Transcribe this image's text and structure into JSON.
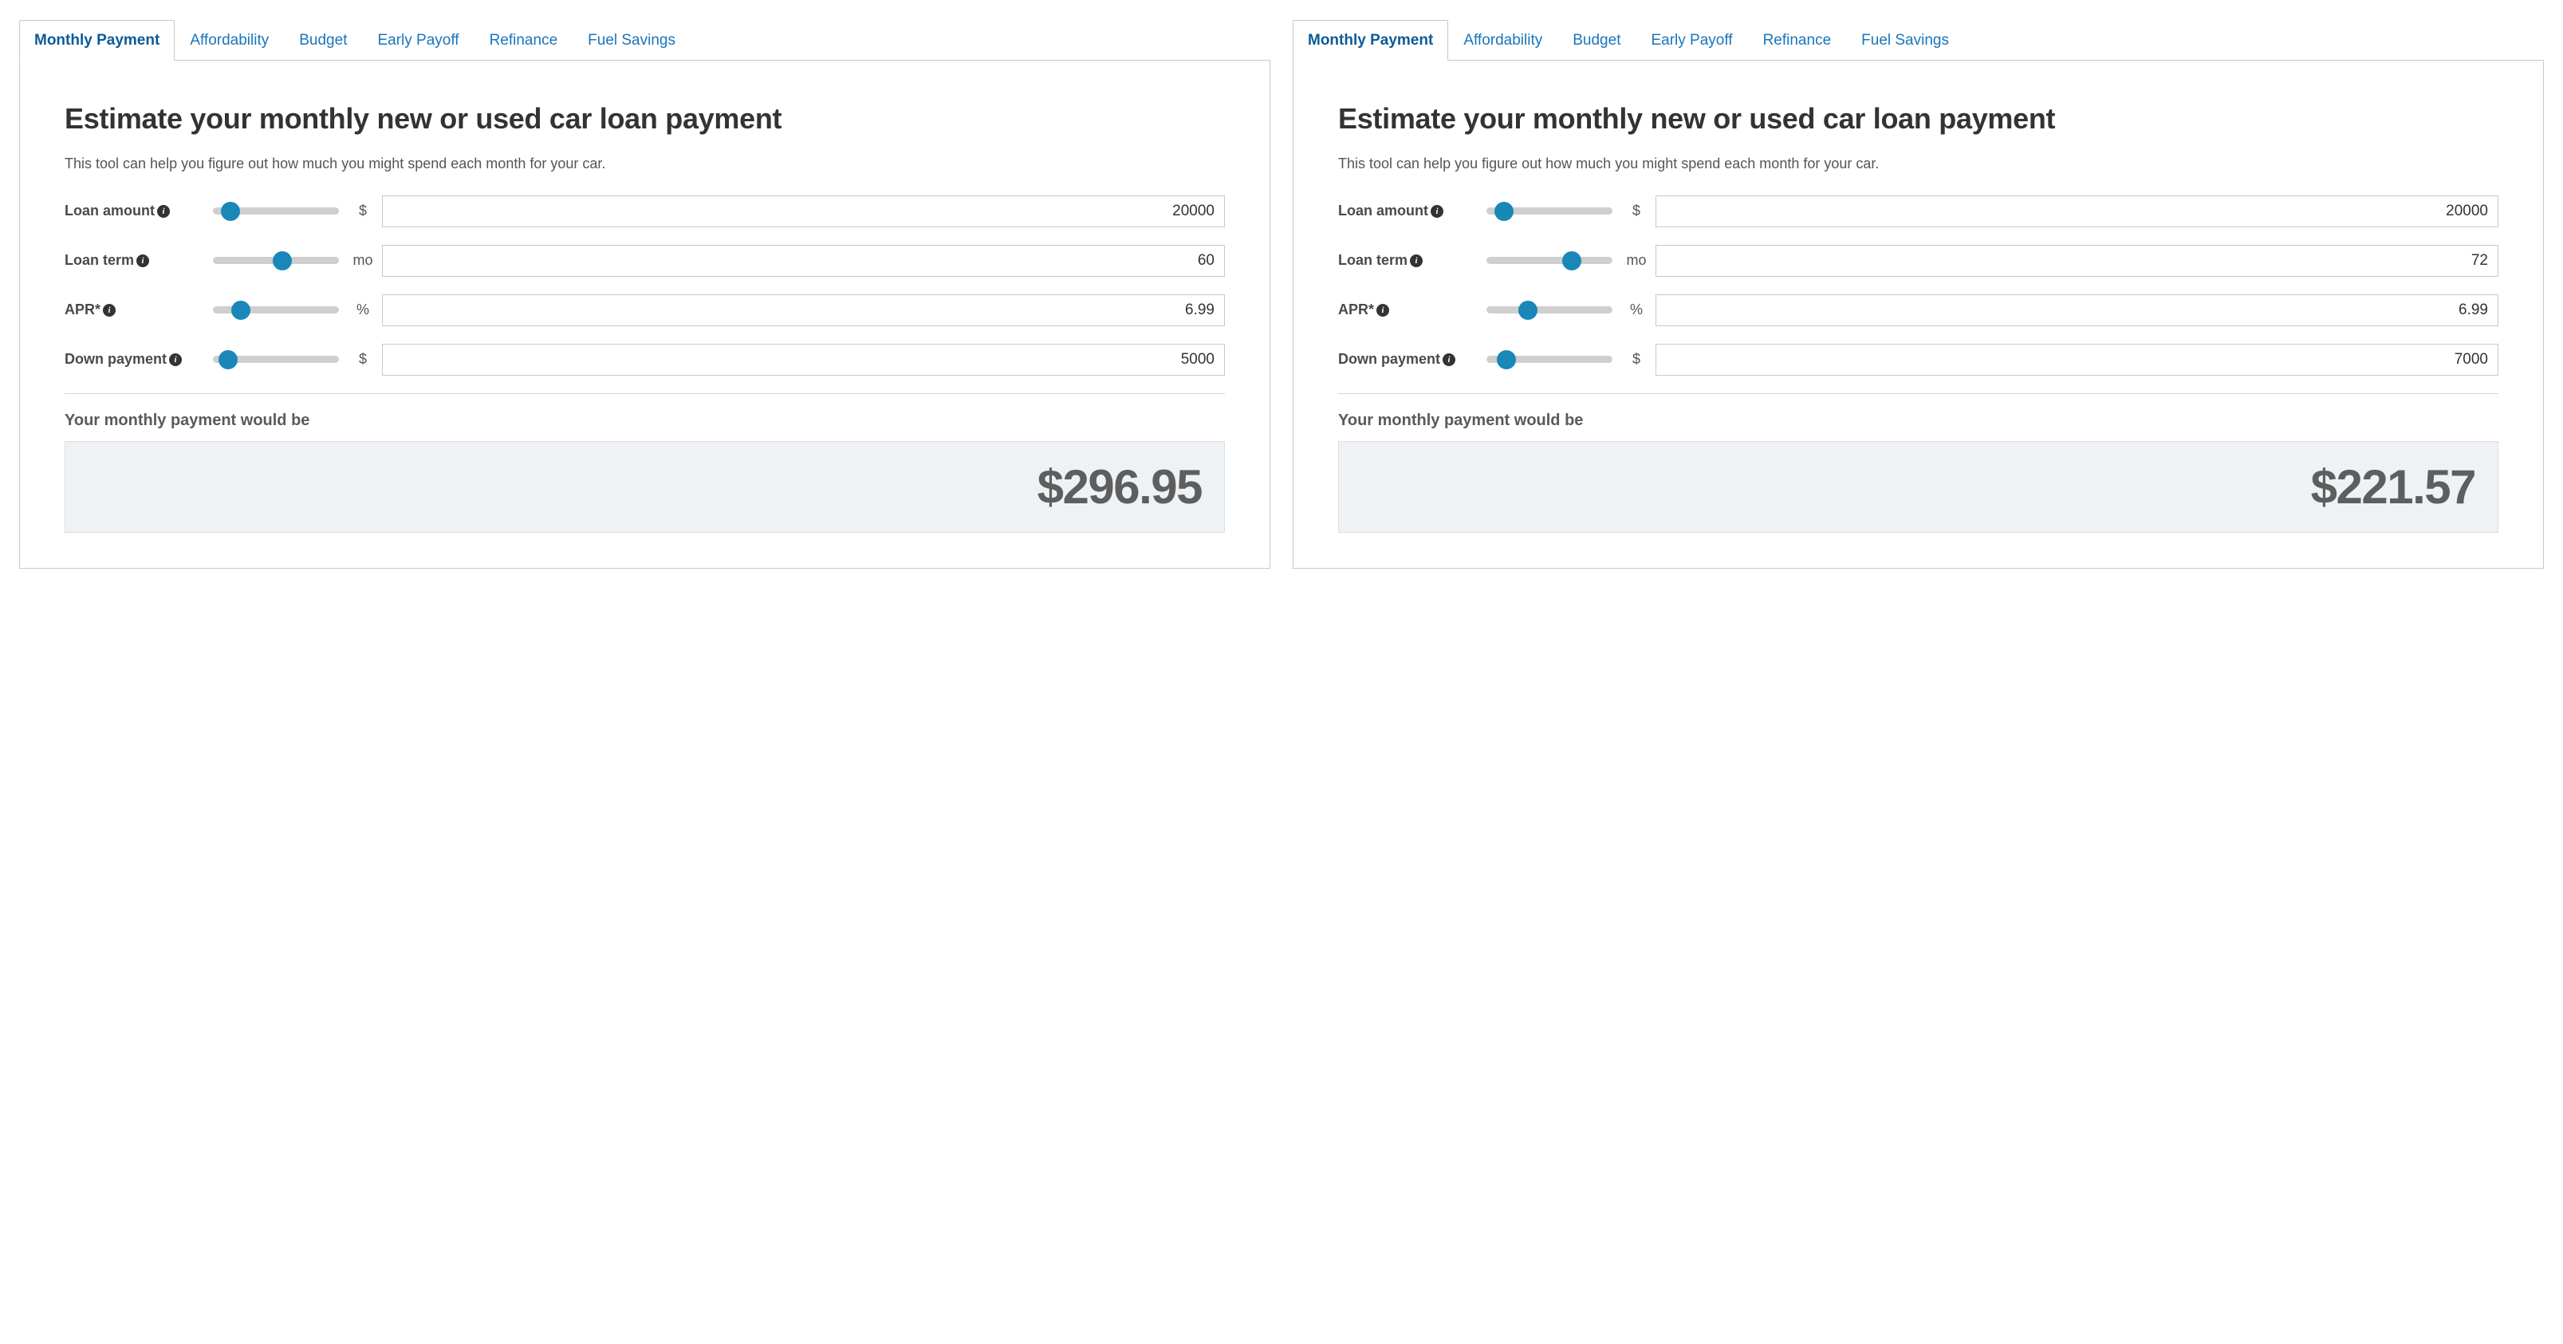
{
  "tabs": [
    "Monthly Payment",
    "Affordability",
    "Budget",
    "Early Payoff",
    "Refinance",
    "Fuel Savings"
  ],
  "active_tab_index": 0,
  "heading": "Estimate your monthly new or used car loan payment",
  "subheading": "This tool can help you figure out how much you might spend each month for your car.",
  "field_labels": {
    "loan_amount": "Loan amount",
    "loan_term": "Loan term",
    "apr": "APR*",
    "down_payment": "Down payment"
  },
  "units": {
    "dollar": "$",
    "month": "mo",
    "percent": "%"
  },
  "result_label": "Your monthly payment would be",
  "info_glyph": "i",
  "panels": [
    {
      "loan_amount": {
        "value": "20000",
        "slider_pct": 14
      },
      "loan_term": {
        "value": "60",
        "slider_pct": 55
      },
      "apr": {
        "value": "6.99",
        "slider_pct": 22
      },
      "down_payment": {
        "value": "5000",
        "slider_pct": 12
      },
      "result": "$296.95"
    },
    {
      "loan_amount": {
        "value": "20000",
        "slider_pct": 14
      },
      "loan_term": {
        "value": "72",
        "slider_pct": 68
      },
      "apr": {
        "value": "6.99",
        "slider_pct": 33
      },
      "down_payment": {
        "value": "7000",
        "slider_pct": 16
      },
      "result": "$221.57"
    }
  ]
}
